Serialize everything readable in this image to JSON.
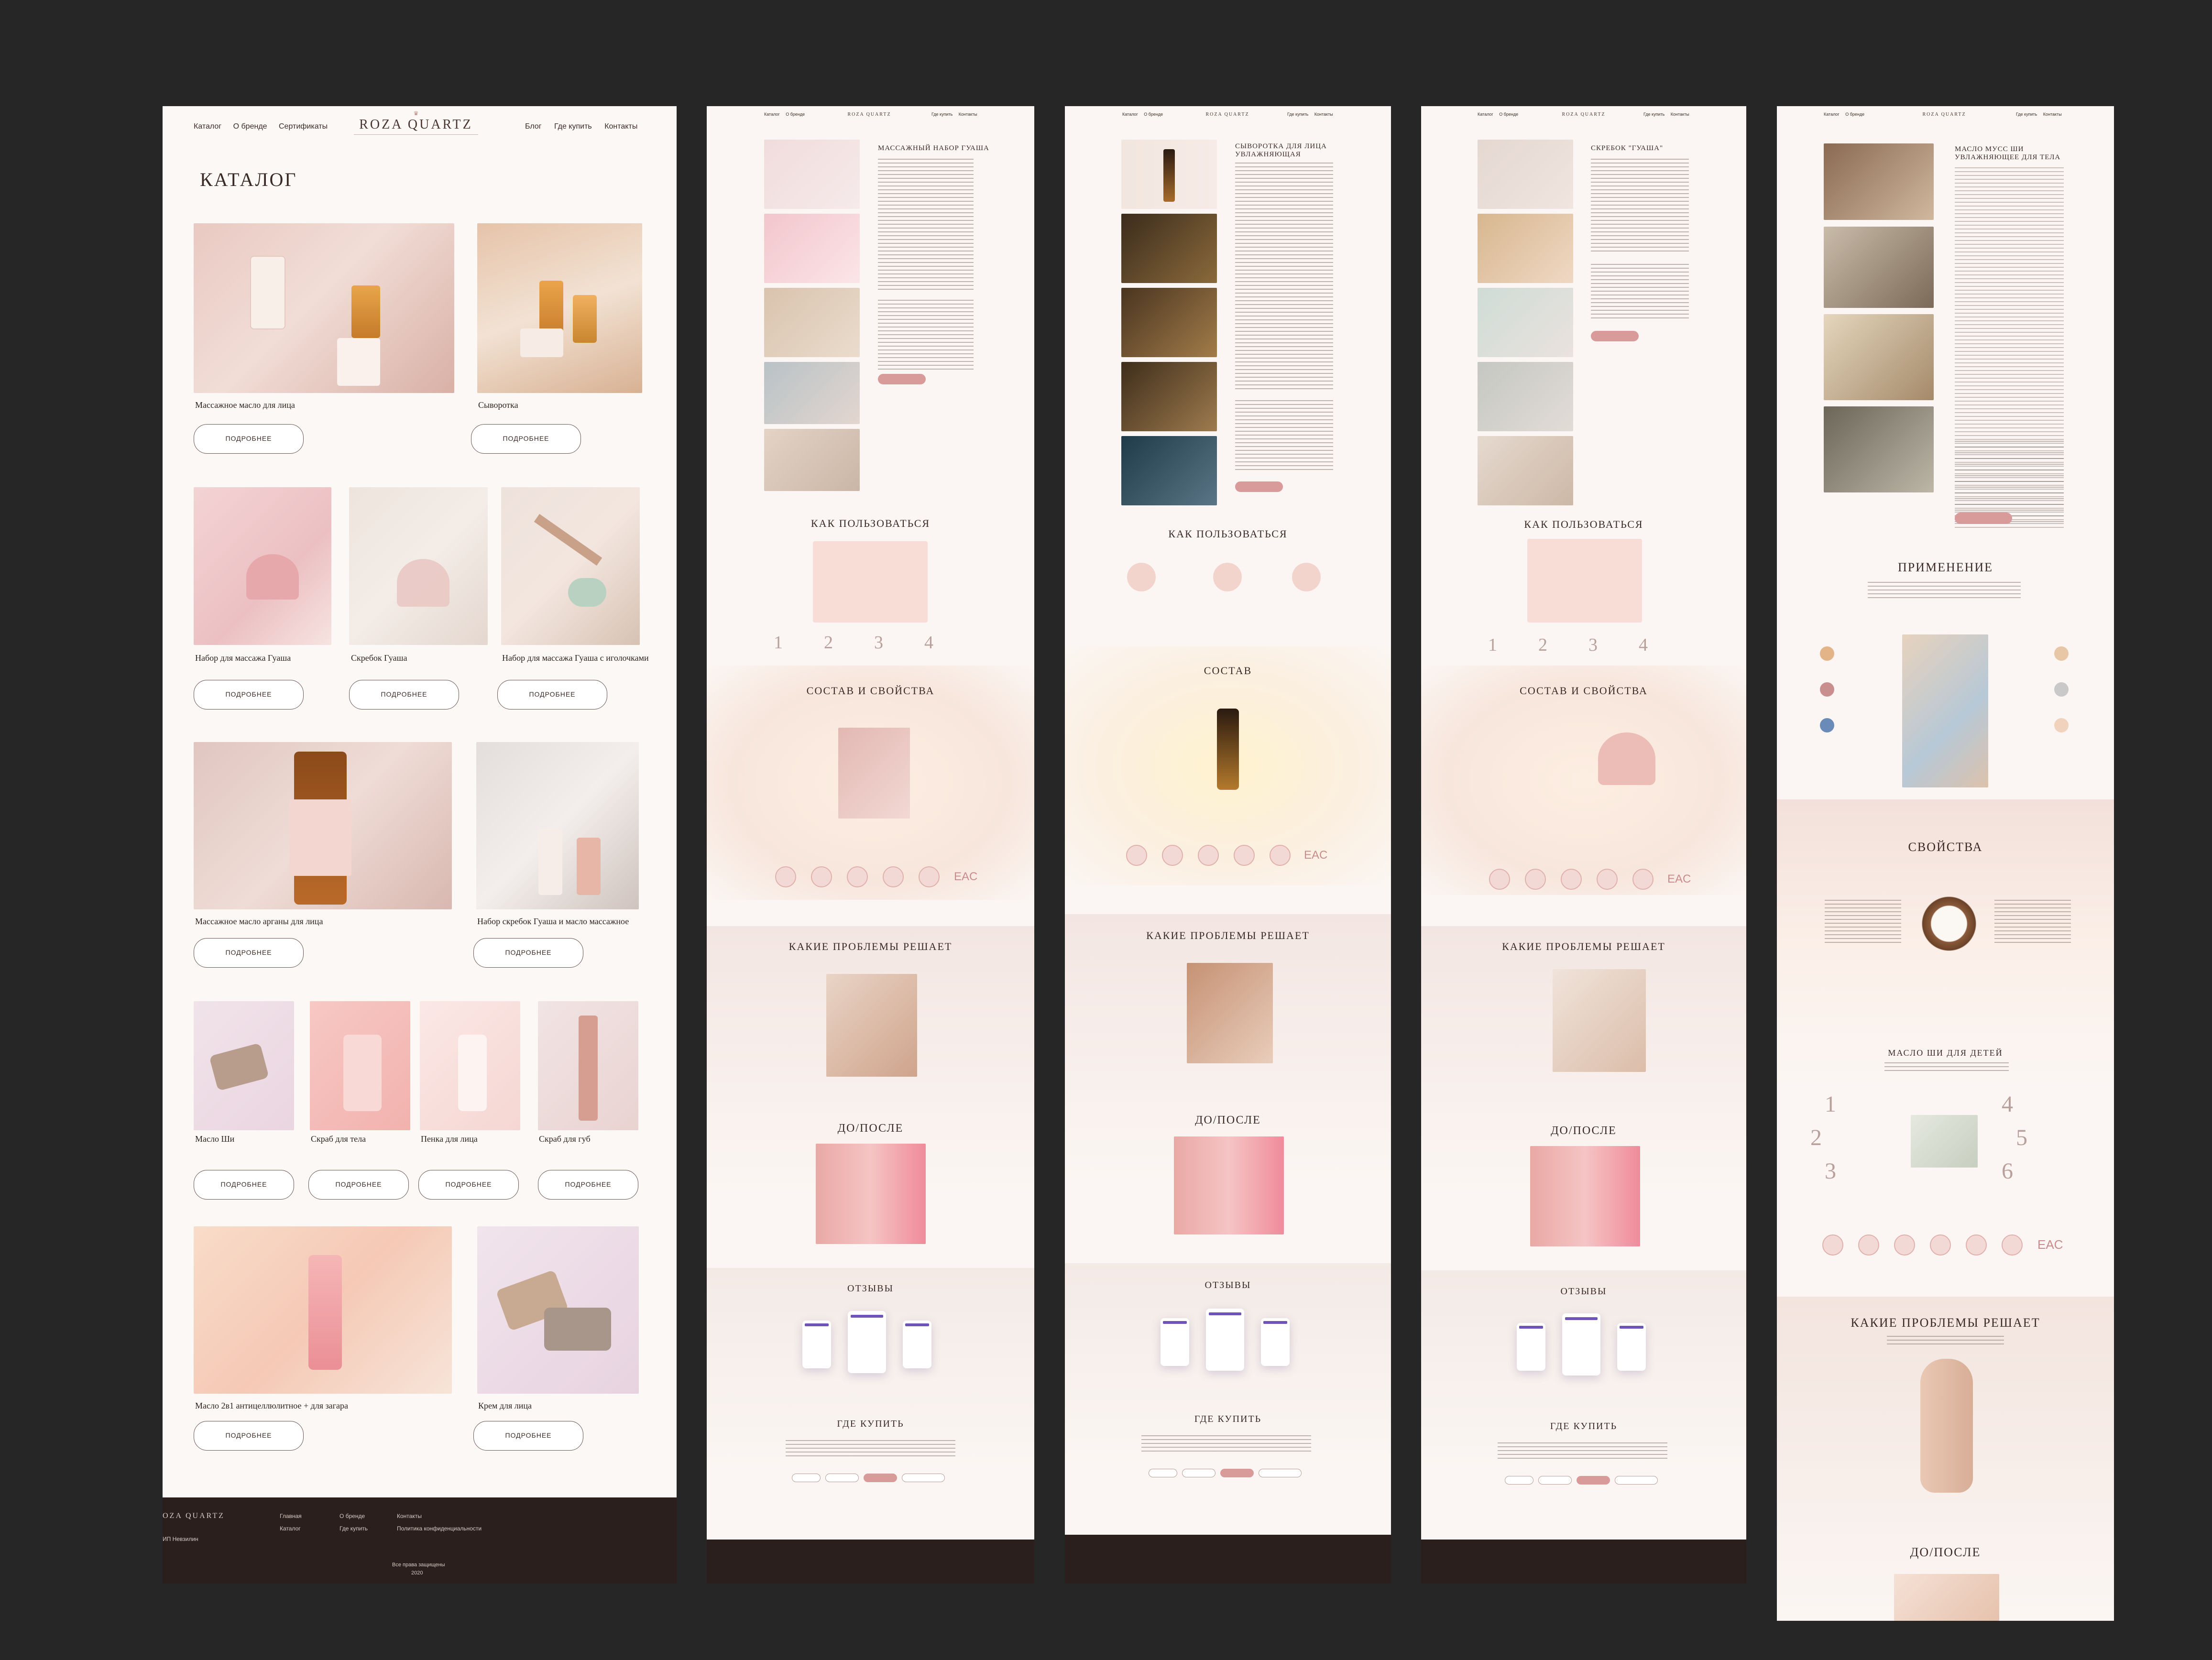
{
  "brand": {
    "logo": "ROZA QUARTZ",
    "footer_logo": "OZA QUARTZ"
  },
  "main_nav": {
    "left": [
      "Каталог",
      "О бренде",
      "Сертификаты"
    ],
    "right": [
      "Блог",
      "Где купить",
      "Контакты"
    ]
  },
  "small_nav": {
    "left": [
      "Каталог",
      "О бренде"
    ],
    "right": [
      "Где купить",
      "Контакты"
    ]
  },
  "catalog": {
    "title": "КАТАЛОГ",
    "button_label": "ПОДРОБНЕЕ",
    "products": [
      "Массажное масло для лица",
      "Сыворотка",
      "Набор для массажа Гуаша",
      "Скребок Гуаша",
      "Набор для массажа Гуаша с иголочками",
      "Массажное масло арганы для лица",
      "Набор скребок Гуаша и масло массажное",
      "Масло Ши",
      "Скраб для тела",
      "Пенка для лица",
      "Скраб для губ",
      "Масло 2в1 антицеллюлитное + для загара",
      "Крем для лица"
    ]
  },
  "footer": {
    "links": [
      "Главная",
      "Каталог",
      "О бренде",
      "Где купить",
      "Контакты",
      "Политика конфиденциальности"
    ],
    "company": "ИП Невзилин",
    "copyright": "Все права защищены",
    "year": "2020"
  },
  "pages": {
    "p2_title": "МАССАЖНЫЙ НАБОР ГУАША",
    "p3_title": "СЫВОРОТКА ДЛЯ ЛИЦА УВЛАЖНЯЮЩАЯ",
    "p4_title": "СКРЕБОК \"ГУАША\"",
    "p5_title": "МАСЛО МУСС ШИ УВЛАЖНЯЮЩЕЕ ДЛЯ ТЕЛА"
  },
  "sections": {
    "how_to_use": "КАК ПОЛЬЗОВАТЬСЯ",
    "composition_props": "СОСТАВ И СВОЙСТВА",
    "composition": "СОСТАВ",
    "problems": "КАКИЕ ПРОБЛЕМЫ РЕШАЕТ",
    "before_after": "ДО/ПОСЛЕ",
    "reviews": "ОТЗЫВЫ",
    "where_to_buy": "ГДЕ КУПИТЬ",
    "application": "ПРИМЕНЕНИЕ",
    "properties": "СВОЙСТВА",
    "kids_oil": "МАСЛО ШИ ДЛЯ ДЕТЕЙ",
    "eac": "EAC"
  },
  "colors": {
    "background": "#262626",
    "page": "#fbf6f3",
    "accent": "#d99a9a",
    "footer": "#2b1f1d",
    "text": "#3a2a26"
  }
}
